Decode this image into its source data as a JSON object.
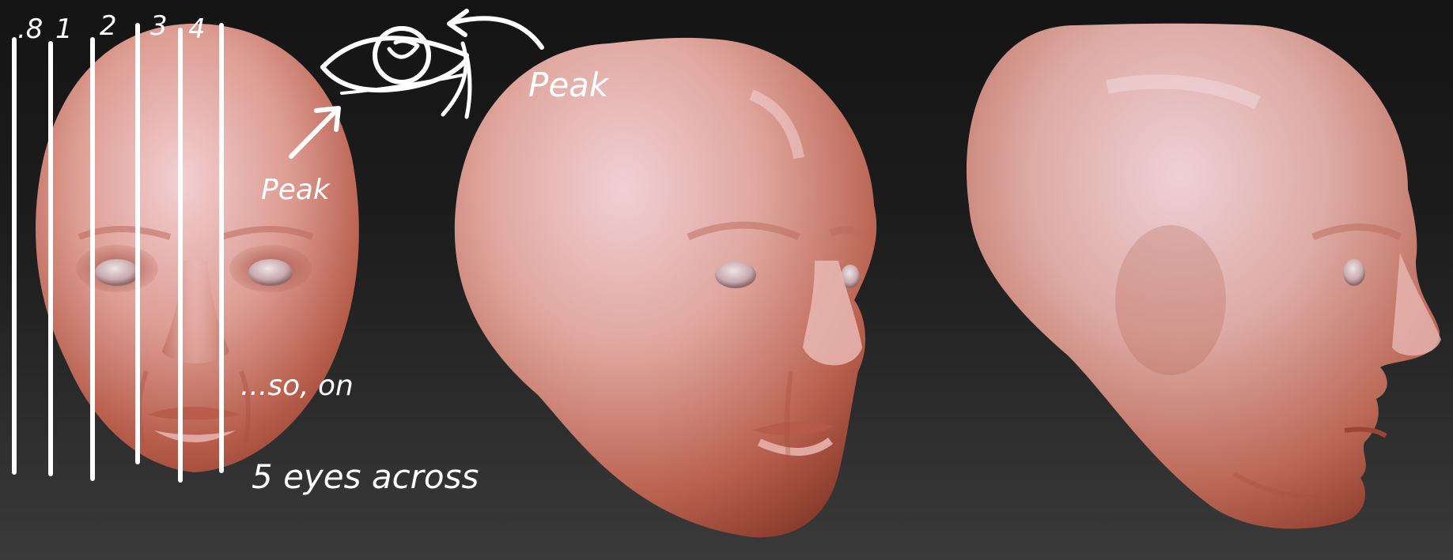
{
  "annotations": {
    "column_labels": [
      ".8",
      "1",
      "2",
      "3",
      "4"
    ],
    "peak_top": "Peak",
    "peak_left": "Peak",
    "so_on": "...so, on",
    "eyes_across": "5 eyes across"
  },
  "colors": {
    "background_top": "#141414",
    "background_bottom": "#3a3a3a",
    "skin_highlight": "#f0c6c8",
    "skin_mid": "#d18878",
    "skin_shadow": "#9a4636",
    "annotation": "#ffffff"
  },
  "views": [
    "front",
    "three-quarter",
    "profile"
  ]
}
